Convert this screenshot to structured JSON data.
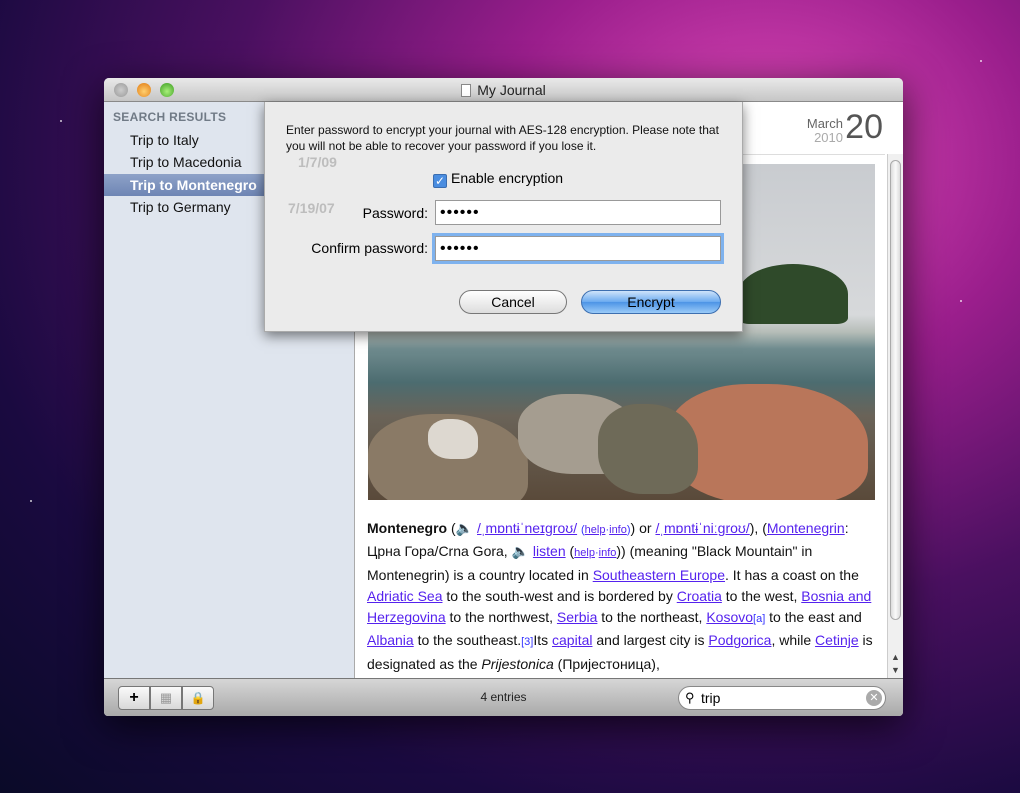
{
  "window": {
    "title": "My Journal"
  },
  "sidebar": {
    "header": "SEARCH RESULTS",
    "items": [
      {
        "label": "Trip to Italy"
      },
      {
        "label": "Trip to Macedonia"
      },
      {
        "label": "Trip to Montenegro",
        "selected": true
      },
      {
        "label": "Trip to Germany"
      }
    ],
    "dates": [
      "1/7/09",
      "7/19/07"
    ]
  },
  "entry": {
    "month": "March",
    "year": "2010",
    "day": "20",
    "article": {
      "p1": "Montenegro",
      "p2": " (",
      "ipa1": "/ˌmɒntɨˈneɪɡroʊ/",
      "help1": "help",
      "info1": "info",
      "p3": ") or ",
      "ipa2": "/ˌmɒntɨˈniːɡroʊ/",
      "p4": "), (",
      "l_mne": "Montenegrin",
      "p5": ": Црна Гора/Crna Gora, ",
      "listen": "listen",
      "p6": " (",
      "help2": "help",
      "info2": "info",
      "p7": ")) (meaning \"Black Mountain\" in Montenegrin) is a country located in ",
      "l_see": "Southeastern Europe",
      "p8": ". It has a coast on the ",
      "l_adr": "Adriatic Sea",
      "p9": " to the south-west and is bordered by ",
      "l_cro": "Croatia",
      "p10": " to the west, ",
      "l_bih": "Bosnia and Herzegovina",
      "p11": " to the northwest, ",
      "l_ser": "Serbia",
      "p12": " to the northeast, ",
      "l_kos": "Kosovo",
      "n_a": "[a]",
      "p13": " to the east and ",
      "l_alb": "Albania",
      "p14": " to the southeast.",
      "n_3": "[3]",
      "p15": "Its ",
      "l_cap": "capital",
      "p16": " and largest city is ",
      "l_pod": "Podgorica",
      "p17": ", while ",
      "l_cet": "Cetinje",
      "p18": " is designated as the ",
      "pri": "Prijestonica",
      "p19": " (Пријестоница),"
    }
  },
  "bottom": {
    "entries": "4 entries",
    "search_value": "trip"
  },
  "dialog": {
    "message": "Enter password to encrypt your journal with AES-128 encryption. Please note that you will not be able to recover your password if you lose it.",
    "checkbox_label": "Enable encryption",
    "checkbox_checked": true,
    "password_label": "Password:",
    "password_value": "••••••",
    "confirm_label": "Confirm password:",
    "confirm_value": "••••••",
    "cancel": "Cancel",
    "encrypt": "Encrypt"
  }
}
